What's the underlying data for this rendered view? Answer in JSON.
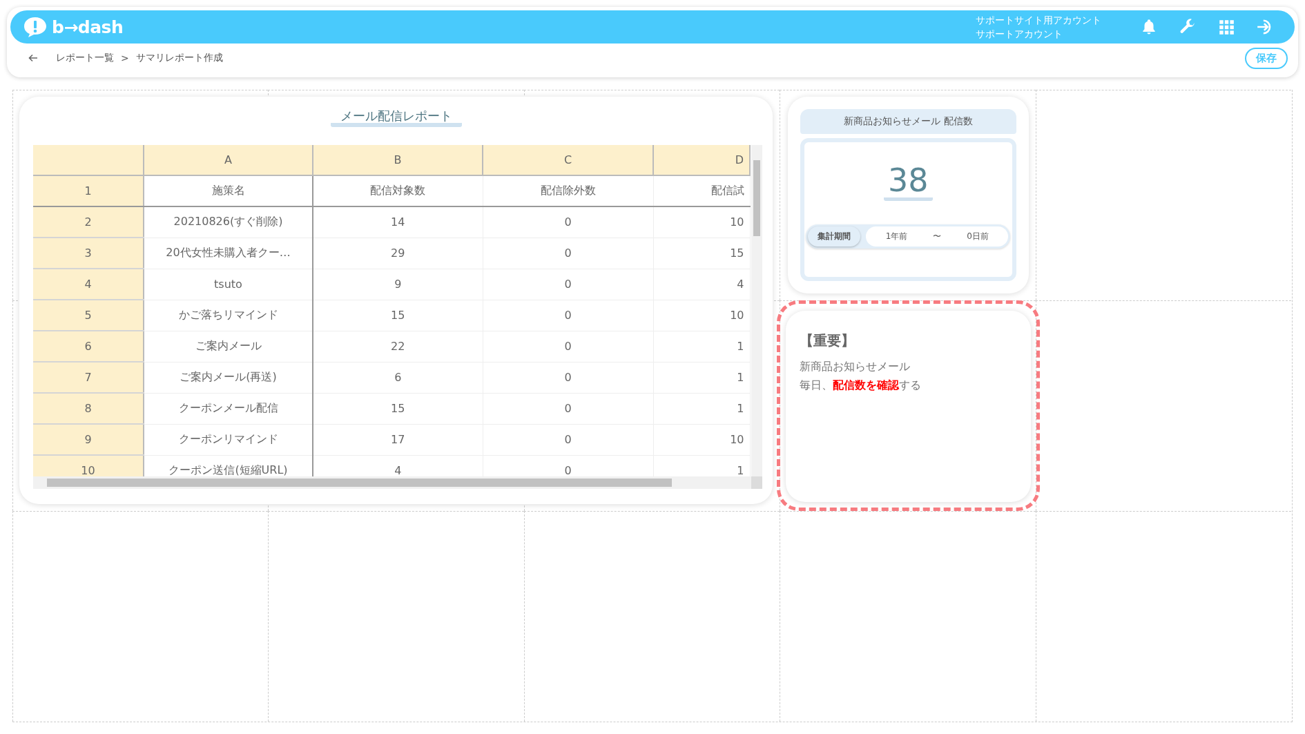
{
  "header": {
    "logo": "b→dash",
    "account_lines": [
      "サポートサイト用アカウント",
      "サポートアカウント"
    ]
  },
  "breadcrumb": {
    "items": [
      "レポート一覧",
      "サマリレポート作成"
    ],
    "separator": ">"
  },
  "save_button": "保存",
  "table_widget": {
    "title": "メール配信レポート",
    "columns": [
      "A",
      "B",
      "C",
      "D"
    ],
    "rows": [
      {
        "number": "1",
        "cells": [
          "施策名",
          "配信対象数",
          "配信除外数",
          "配信試"
        ]
      },
      {
        "number": "2",
        "cells": [
          "20210826(すぐ削除)",
          "14",
          "0",
          "10"
        ]
      },
      {
        "number": "3",
        "cells": [
          "20代女性未購入者クー…",
          "29",
          "0",
          "15"
        ]
      },
      {
        "number": "4",
        "cells": [
          "tsuto",
          "9",
          "0",
          "4"
        ]
      },
      {
        "number": "5",
        "cells": [
          "かご落ちリマインド",
          "15",
          "0",
          "10"
        ]
      },
      {
        "number": "6",
        "cells": [
          "ご案内メール",
          "22",
          "0",
          "1"
        ]
      },
      {
        "number": "7",
        "cells": [
          "ご案内メール(再送)",
          "6",
          "0",
          "1"
        ]
      },
      {
        "number": "8",
        "cells": [
          "クーポンメール配信",
          "15",
          "0",
          "1"
        ]
      },
      {
        "number": "9",
        "cells": [
          "クーポンリマインド",
          "17",
          "0",
          "10"
        ]
      },
      {
        "number": "10",
        "cells": [
          "クーポン送信(短縮URL)",
          "4",
          "0",
          "1"
        ]
      }
    ]
  },
  "count_widget": {
    "title": "新商品お知らせメール 配信数",
    "value": "38",
    "period_label": "集計期間",
    "period_from": "1年前",
    "period_sep": "〜",
    "period_to": "0日前"
  },
  "note_widget": {
    "title": "【重要】",
    "lines": [
      "新商品お知らせメール",
      "毎日、**配信数を確認**する"
    ]
  }
}
